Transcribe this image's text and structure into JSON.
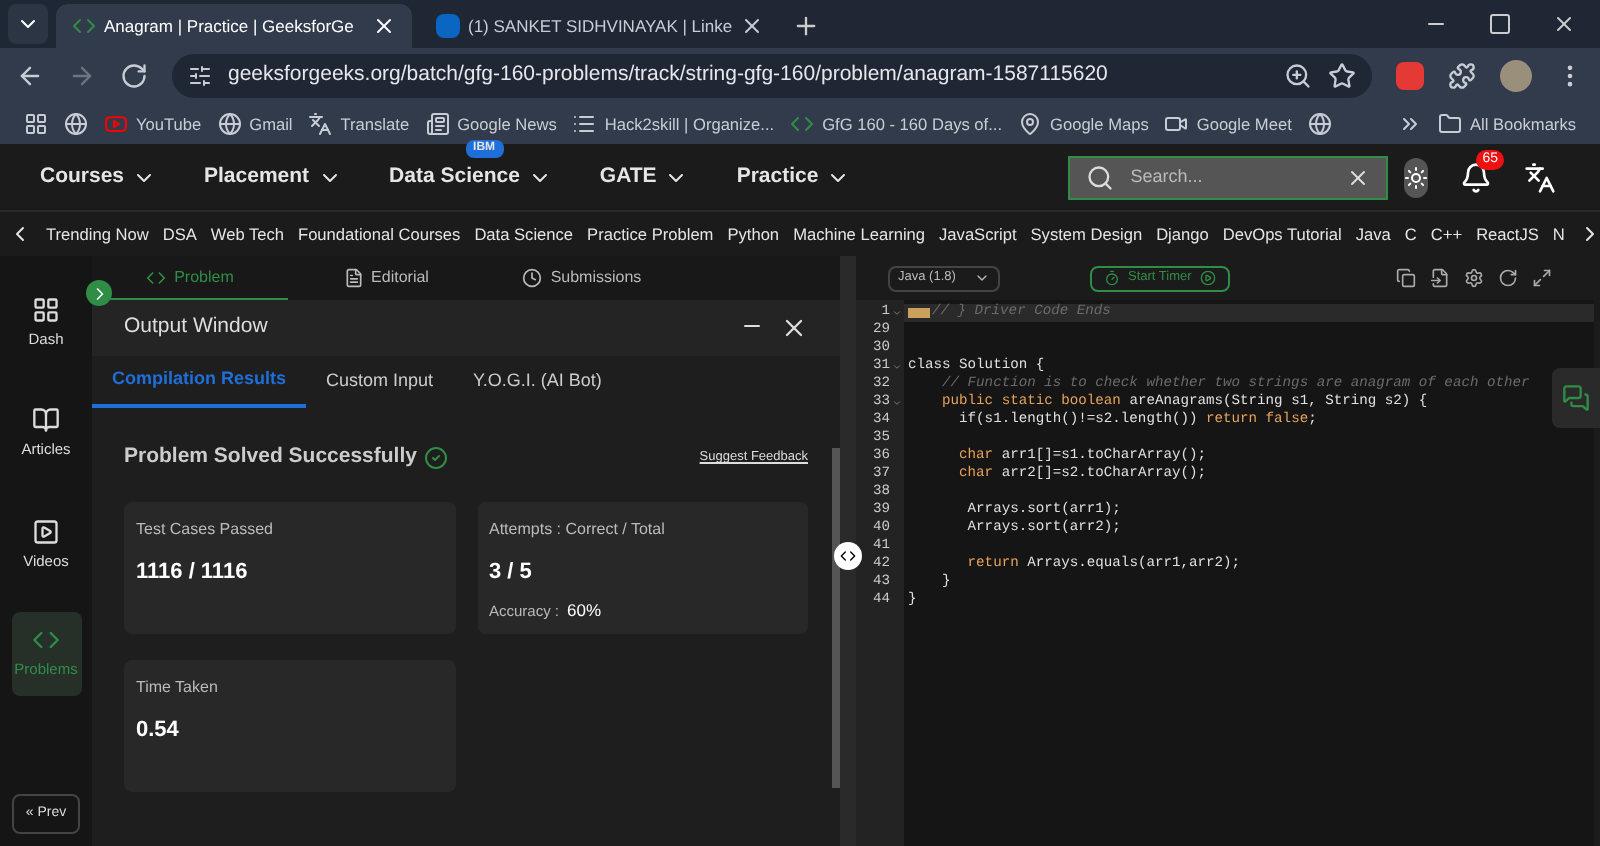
{
  "browser": {
    "tabs": [
      {
        "title": "Anagram | Practice | GeeksforGe",
        "selected": true,
        "kind": "gfg"
      },
      {
        "title": "(1) SANKET SIDHVINAYAK | Linke",
        "selected": false,
        "kind": "linkedin"
      }
    ],
    "url": "geeksforgeeks.org/batch/gfg-160-problems/track/string-gfg-160/problem/anagram-1587115620",
    "bookmarks": [
      {
        "label": "YouTube",
        "kind": "youtube"
      },
      {
        "label": "Gmail",
        "kind": "globe"
      },
      {
        "label": "Translate",
        "kind": "translate"
      },
      {
        "label": "Google News",
        "kind": "news"
      },
      {
        "label": "Hack2skill | Organize...",
        "kind": "list"
      },
      {
        "label": "GfG 160 - 160 Days of...",
        "kind": "gfg"
      },
      {
        "label": "Google Maps",
        "kind": "google"
      },
      {
        "label": "Google Meet",
        "kind": "meet"
      }
    ],
    "all_bookmarks": "All Bookmarks"
  },
  "site_nav": {
    "items": [
      {
        "label": "Courses"
      },
      {
        "label": "Placement"
      },
      {
        "label": "Data Science",
        "badge": "IBM"
      },
      {
        "label": "GATE"
      },
      {
        "label": "Practice"
      }
    ],
    "search": {
      "placeholder": "Search..."
    },
    "notifications": "65"
  },
  "categories": [
    "Trending Now",
    "DSA",
    "Web Tech",
    "Foundational Courses",
    "Data Science",
    "Practice Problem",
    "Python",
    "Machine Learning",
    "JavaScript",
    "System Design",
    "Django",
    "DevOps Tutorial",
    "Java",
    "C",
    "C++",
    "ReactJS",
    "N"
  ],
  "sidebar": {
    "items": [
      {
        "label": "Dash",
        "kind": "dash",
        "selected": false
      },
      {
        "label": "Articles",
        "kind": "book",
        "selected": false
      },
      {
        "label": "Videos",
        "kind": "video",
        "selected": false
      },
      {
        "label": "Problems",
        "kind": "code",
        "selected": true
      }
    ],
    "prev": "« Prev"
  },
  "problem_tabs": [
    {
      "label": "Problem",
      "kind": "code",
      "selected": true
    },
    {
      "label": "Editorial",
      "kind": "doc",
      "selected": false
    },
    {
      "label": "Submissions",
      "kind": "clock",
      "selected": false
    }
  ],
  "output": {
    "title": "Output Window",
    "tabs": [
      {
        "label": "Compilation Results",
        "selected": true
      },
      {
        "label": "Custom Input",
        "selected": false
      },
      {
        "label": "Y.O.G.I. (AI Bot)",
        "selected": false
      }
    ],
    "status": "Problem Solved Successfully",
    "feedback": "Suggest Feedback",
    "cards": [
      {
        "label": "Test Cases Passed",
        "value": "1116 / 1116"
      },
      {
        "label": "Attempts : Correct / Total",
        "value": "3 / 5",
        "extra_label": "Accuracy :",
        "extra_value": "60%"
      },
      {
        "label": "Time Taken",
        "value": "0.54"
      }
    ]
  },
  "editor": {
    "language": "Java (1.8)",
    "timer": "Start Timer",
    "lines": [
      {
        "number": "1",
        "foldable": true,
        "folded": true,
        "tokens": [
          {
            "kind": "comment",
            "text": "// } Driver Code Ends"
          }
        ]
      },
      {
        "number": "29",
        "foldable": false,
        "folded": false
      },
      {
        "number": "30",
        "foldable": false,
        "folded": false
      },
      {
        "number": "31",
        "foldable": true,
        "folded": false,
        "tokens": [
          {
            "kind": "plain",
            "text": "class Solution {"
          }
        ]
      },
      {
        "number": "32",
        "foldable": false,
        "folded": false,
        "tokens": [
          {
            "kind": "comment",
            "text": "    // Function is to check whether two strings are anagram of each other"
          }
        ]
      },
      {
        "number": "33",
        "foldable": true,
        "folded": false,
        "tokens": [
          {
            "kind": "keyword",
            "text": "    public static boolean "
          },
          {
            "kind": "plain",
            "text": "areAnagrams(String s1, String s2) {"
          }
        ]
      },
      {
        "number": "34",
        "foldable": false,
        "folded": false,
        "tokens": [
          {
            "kind": "plain",
            "text": "      if(s1.length()!=s2.length()) "
          },
          {
            "kind": "keyword",
            "text": "return false"
          },
          {
            "kind": "plain",
            "text": ";"
          }
        ]
      },
      {
        "number": "35",
        "foldable": false,
        "folded": false
      },
      {
        "number": "36",
        "foldable": false,
        "folded": false,
        "tokens": [
          {
            "kind": "keyword",
            "text": "      char "
          },
          {
            "kind": "plain",
            "text": "arr1[]=s1.toCharArray();"
          }
        ]
      },
      {
        "number": "37",
        "foldable": false,
        "folded": false,
        "tokens": [
          {
            "kind": "keyword",
            "text": "      char "
          },
          {
            "kind": "plain",
            "text": "arr2[]=s2.toCharArray();"
          }
        ]
      },
      {
        "number": "38",
        "foldable": false,
        "folded": false
      },
      {
        "number": "39",
        "foldable": false,
        "folded": false,
        "tokens": [
          {
            "kind": "plain",
            "text": "       Arrays.sort(arr1);"
          }
        ]
      },
      {
        "number": "40",
        "foldable": false,
        "folded": false,
        "tokens": [
          {
            "kind": "plain",
            "text": "       Arrays.sort(arr2);"
          }
        ]
      },
      {
        "number": "41",
        "foldable": false,
        "folded": false
      },
      {
        "number": "42",
        "foldable": false,
        "folded": false,
        "tokens": [
          {
            "kind": "keyword",
            "text": "       return "
          },
          {
            "kind": "plain",
            "text": "Arrays.equals(arr1,arr2);"
          }
        ]
      },
      {
        "number": "43",
        "foldable": false,
        "folded": false,
        "tokens": [
          {
            "kind": "plain",
            "text": "    }"
          }
        ]
      },
      {
        "number": "44",
        "foldable": false,
        "folded": false,
        "tokens": [
          {
            "kind": "plain",
            "text": "}"
          }
        ]
      }
    ]
  }
}
